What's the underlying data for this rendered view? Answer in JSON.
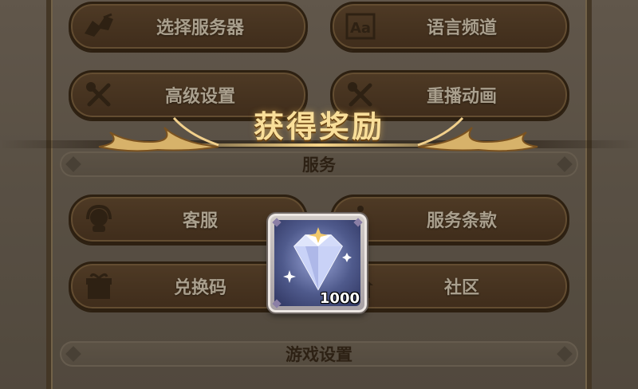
{
  "settings_panel": {
    "buttons": [
      {
        "label": "选择服务器",
        "icon": "feather-map-icon"
      },
      {
        "label": "语言频道",
        "icon": "font-aa-icon"
      },
      {
        "label": "高级设置",
        "icon": "wrench-screwdriver-icon"
      },
      {
        "label": "重播动画",
        "icon": "wrench-screwdriver-icon"
      },
      {
        "label": "客服",
        "icon": "headset-agent-icon"
      },
      {
        "label": "服务条款",
        "icon": "info-icon"
      },
      {
        "label": "兑换码",
        "icon": "gift-icon"
      },
      {
        "label": "社区",
        "icon": "house-icon"
      }
    ],
    "sections": [
      {
        "label": "服务"
      },
      {
        "label": "游戏设置"
      }
    ]
  },
  "reward_popup": {
    "title": "获得奖励",
    "item": {
      "name": "diamond",
      "quantity": "1000"
    }
  },
  "colors": {
    "button_bg": "#5f4529",
    "button_text": "#f0e3cc",
    "title_gold": "#f9df9a",
    "item_frame": "#ede7e3"
  }
}
